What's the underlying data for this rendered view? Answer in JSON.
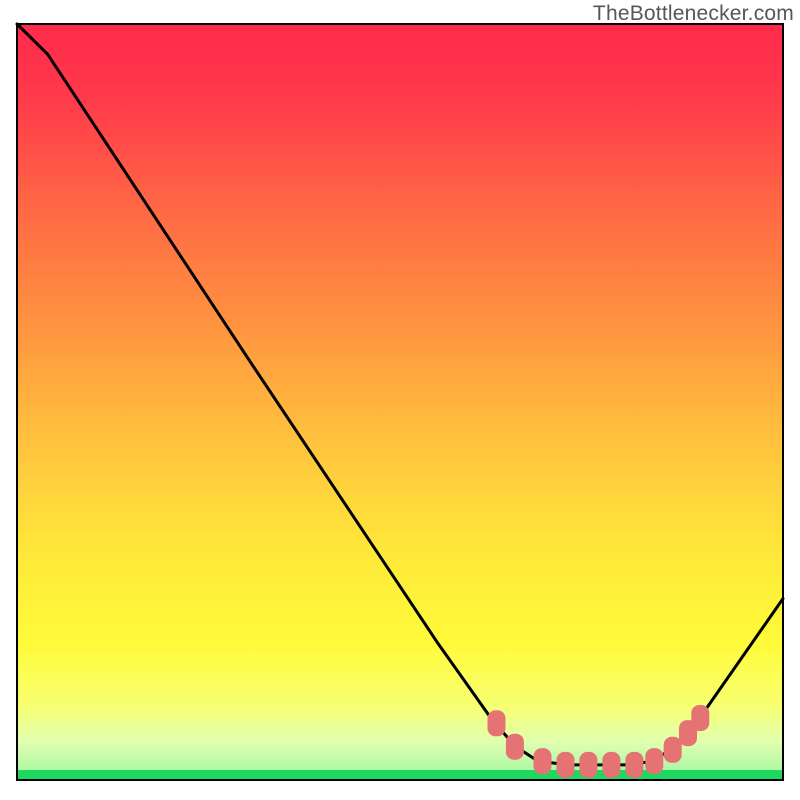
{
  "watermark": "TheBottlenecker.com",
  "chart_data": {
    "type": "line",
    "x": [
      0.0,
      0.04,
      0.3,
      0.55,
      0.62,
      0.65,
      0.68,
      0.72,
      0.76,
      0.8,
      0.83,
      0.86,
      0.89,
      1.0
    ],
    "values": [
      1.0,
      0.96,
      0.56,
      0.18,
      0.08,
      0.045,
      0.025,
      0.02,
      0.02,
      0.02,
      0.025,
      0.045,
      0.08,
      0.24
    ],
    "title": "",
    "xlabel": "",
    "ylabel": "",
    "xlim": [
      0,
      1
    ],
    "ylim": [
      0,
      1
    ],
    "markers": {
      "x": [
        0.626,
        0.65,
        0.686,
        0.716,
        0.746,
        0.776,
        0.806,
        0.832,
        0.856,
        0.876,
        0.892
      ],
      "y": [
        0.075,
        0.044,
        0.025,
        0.02,
        0.02,
        0.02,
        0.02,
        0.025,
        0.04,
        0.062,
        0.082
      ]
    },
    "note": "x and y are normalized 0..1 within the plot area; background gradient spans red→orange→yellow top-to-bottom with a green band at the very bottom"
  }
}
